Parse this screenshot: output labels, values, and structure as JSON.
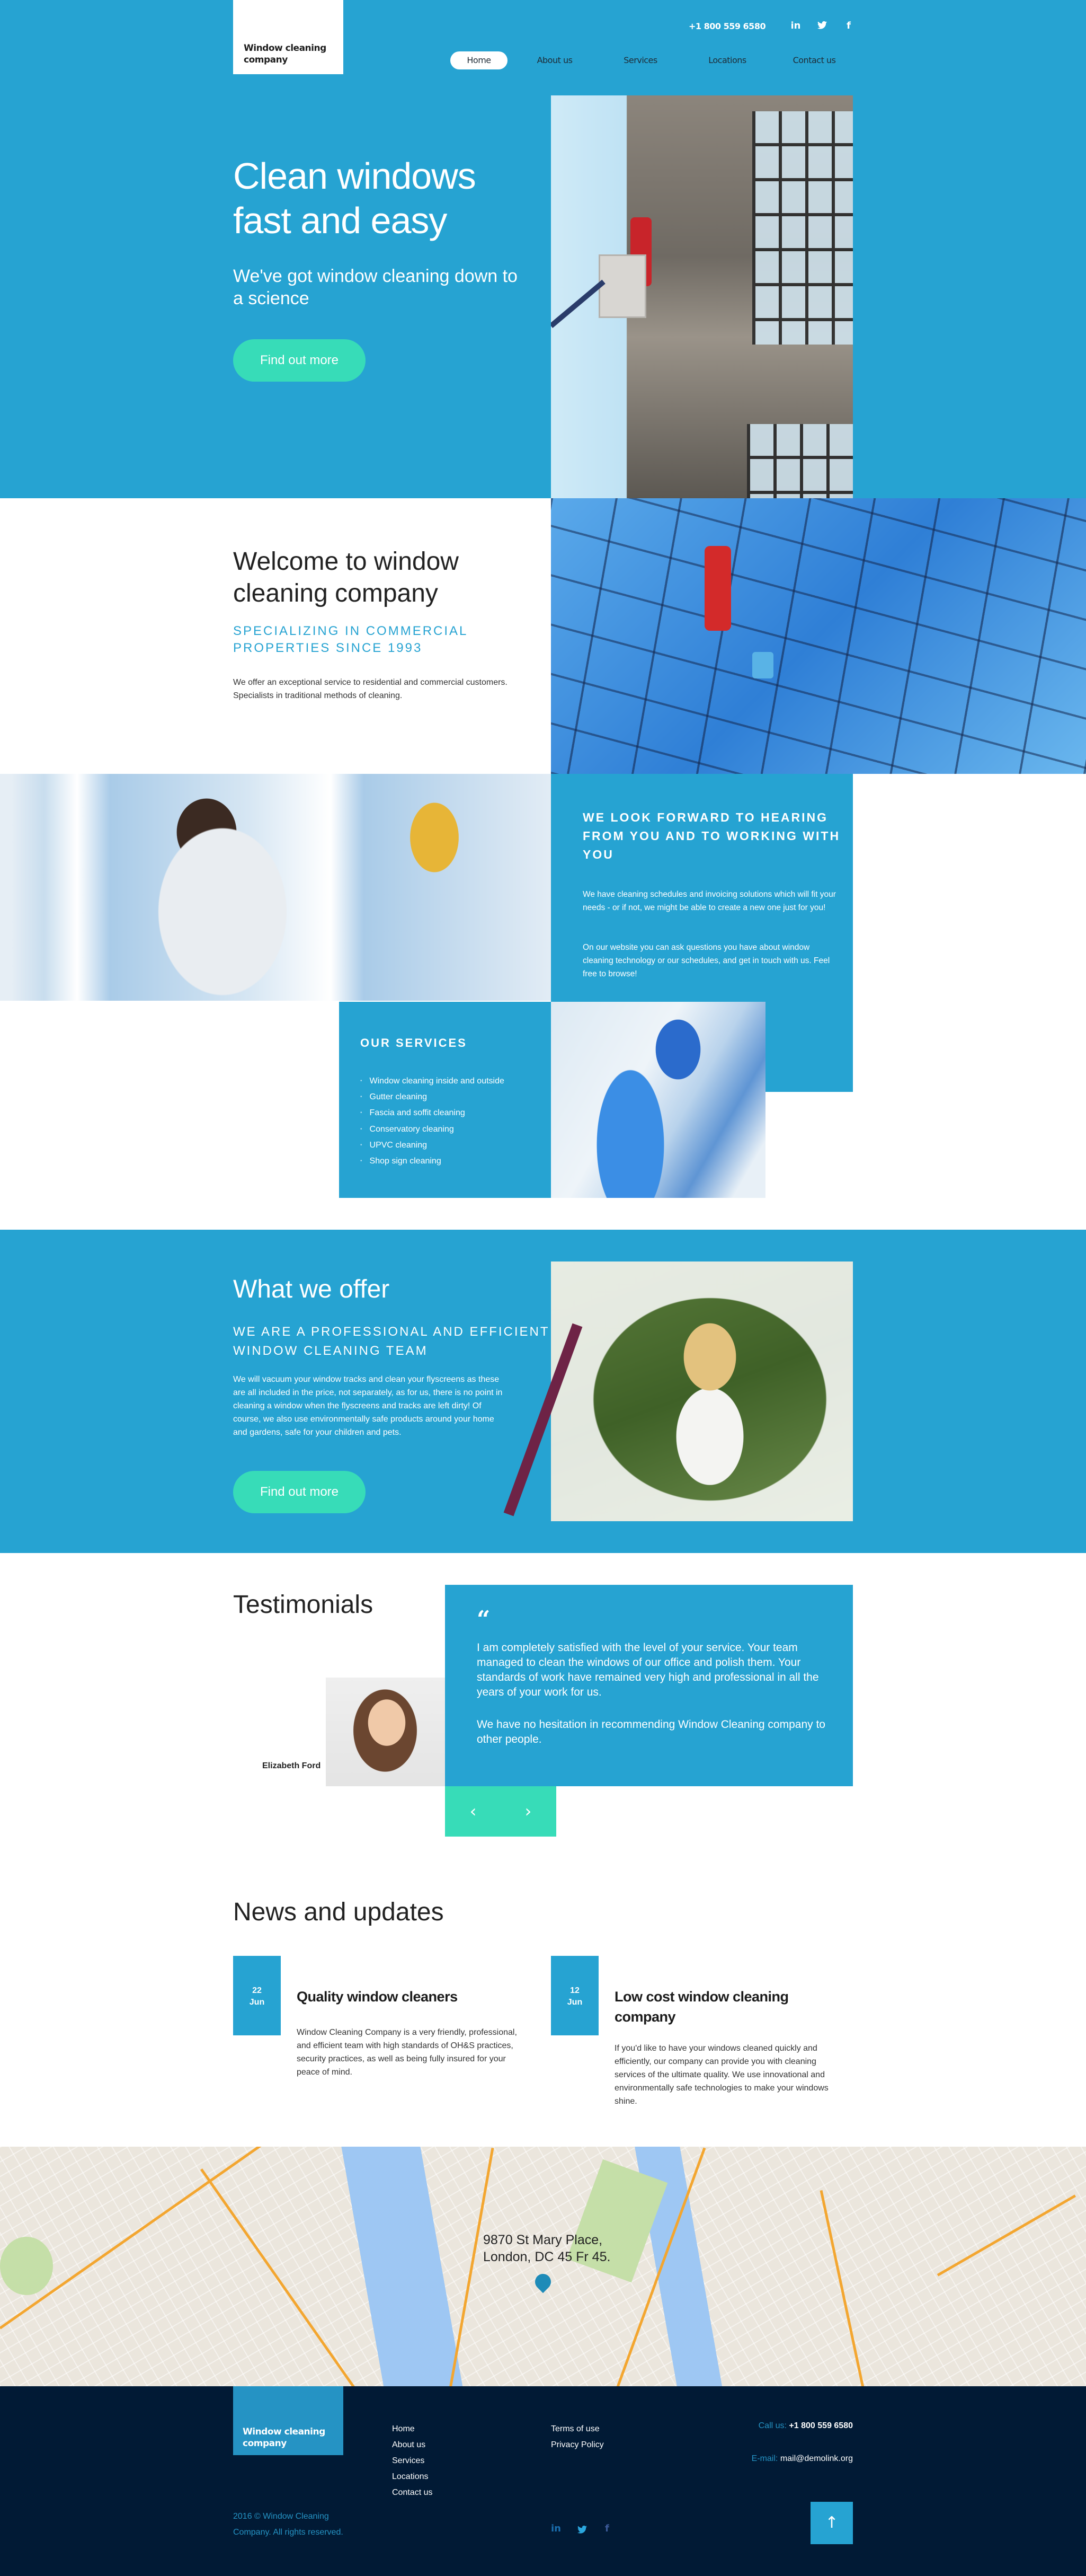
{
  "header": {
    "logo": "Window cleaning company",
    "phone": "+1 800 559 6580",
    "social": [
      {
        "icon": "linkedin-icon",
        "glyph": "in"
      },
      {
        "icon": "twitter-icon",
        "glyph": "🐦"
      },
      {
        "icon": "facebook-icon",
        "glyph": "f"
      }
    ],
    "nav": [
      "Home",
      "About us",
      "Services",
      "Locations",
      "Contact us"
    ],
    "active_nav": "Home"
  },
  "hero": {
    "title": "Clean windows fast and easy",
    "subtitle": "We've got window cleaning down to a science",
    "button": "Find out more"
  },
  "welcome": {
    "title": "Welcome to window cleaning company",
    "tagline": "SPECIALIZING IN COMMERCIAL PROPERTIES SINCE 1993",
    "text": "We offer an exceptional service to residential and commercial customers. Specialists in traditional methods of cleaning."
  },
  "contact_panel": {
    "heading": "WE LOOK FORWARD TO HEARING FROM YOU AND TO WORKING WITH YOU",
    "paragraphs": [
      "We have cleaning schedules and invoicing solutions which will fit your needs - or if not, we might be able to create a new one just for you!",
      "On our website you can ask questions you have about window cleaning technology or our schedules, and get in touch with us. Feel free to browse!"
    ]
  },
  "services": {
    "heading": "OUR SERVICES",
    "items": [
      "Window cleaning inside and outside",
      "Gutter cleaning",
      "Fascia and soffit cleaning",
      "Conservatory cleaning",
      "UPVC cleaning",
      "Shop sign cleaning"
    ]
  },
  "offer": {
    "title": "What we offer",
    "tagline": "WE ARE A PROFESSIONAL AND EFFICIENT WINDOW CLEANING TEAM",
    "text": "We will vacuum your window tracks and clean your flyscreens as these are all included in the price, not separately, as for us, there is no point in cleaning a window when the flyscreens and tracks are left dirty! Of course, we also use environmentally safe products around your home and gardens, safe for your children and pets.",
    "button": "Find out more"
  },
  "testimonials": {
    "title": "Testimonials",
    "quote_mark": "“",
    "paragraphs": [
      "I am completely satisfied with the level of your service. Your team managed to clean the windows of our office and polish them. Your standards of work have remained very high and professional in all the years of your work for us.",
      "We have no hesitation in recommending Window Cleaning company to other people."
    ],
    "author": "Elizabeth Ford",
    "prev": "‹",
    "next": "›"
  },
  "news": {
    "title": "News and updates",
    "items": [
      {
        "day": "22",
        "month": "Jun",
        "headline": "Quality window cleaners",
        "text": "Window Cleaning Company is a very friendly, professional, and efficient team with high standards of OH&S practices, security practices, as well as being fully insured for your peace of mind."
      },
      {
        "day": "12",
        "month": "Jun",
        "headline": "Low cost window cleaning company",
        "text": "If you'd like to have your windows cleaned quickly and efficiently, our company can provide you with cleaning services of the ultimate quality. We use innovational and environmentally safe technologies to make your windows shine."
      }
    ]
  },
  "map": {
    "address_line1": "9870 St Mary Place,",
    "address_line2": "London, DC 45 Fr 45."
  },
  "footer": {
    "logo": "Window cleaning company",
    "nav": [
      "Home",
      "About us",
      "Services",
      "Locations",
      "Contact us"
    ],
    "legal": [
      "Terms of use",
      "Privacy Policy"
    ],
    "call_label": "Call us:",
    "call_value": "+1 800 559 6580",
    "email_label": "E-mail:",
    "email_value": "mail@demolink.org",
    "copyright": "2016 © Window Cleaning Company. All rights reserved.",
    "social": [
      {
        "icon": "linkedin-icon",
        "glyph": "in",
        "color": "#1a6fb0"
      },
      {
        "icon": "twitter-icon",
        "glyph": "🐦",
        "color": "#2ba7de"
      },
      {
        "icon": "facebook-icon",
        "glyph": "f",
        "color": "#3b5998"
      }
    ],
    "to_top": "↑"
  },
  "colors": {
    "primary_blue": "#26a3d2",
    "accent_green": "#37dcb8",
    "footer_navy": "#011a35"
  }
}
